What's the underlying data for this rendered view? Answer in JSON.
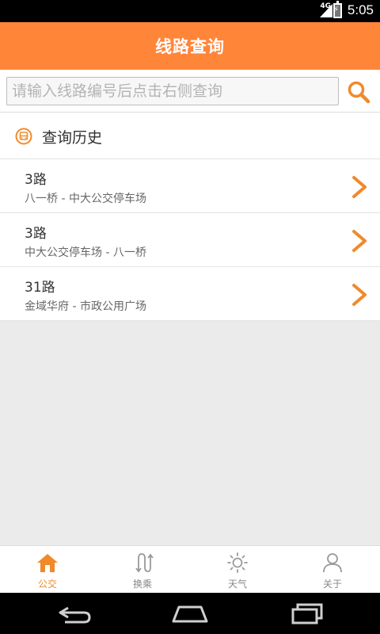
{
  "status_bar": {
    "network": "4G",
    "time": "5:05"
  },
  "header": {
    "title": "线路查询"
  },
  "search": {
    "placeholder": "请输入线路编号后点击右侧查询",
    "value": ""
  },
  "history": {
    "title": "查询历史",
    "items": [
      {
        "route": "3路",
        "desc": "八一桥 - 中大公交停车场"
      },
      {
        "route": "3路",
        "desc": "中大公交停车场 - 八一桥"
      },
      {
        "route": "31路",
        "desc": "金域华府 - 市政公用广场"
      }
    ]
  },
  "tabs": [
    {
      "label": "公交",
      "icon": "home-icon",
      "active": true
    },
    {
      "label": "换乘",
      "icon": "transfer-icon",
      "active": false
    },
    {
      "label": "天气",
      "icon": "sun-icon",
      "active": false
    },
    {
      "label": "关于",
      "icon": "person-icon",
      "active": false
    }
  ],
  "colors": {
    "accent": "#ff8539",
    "icon_orange": "#f08a2a",
    "tab_inactive": "#888888"
  }
}
